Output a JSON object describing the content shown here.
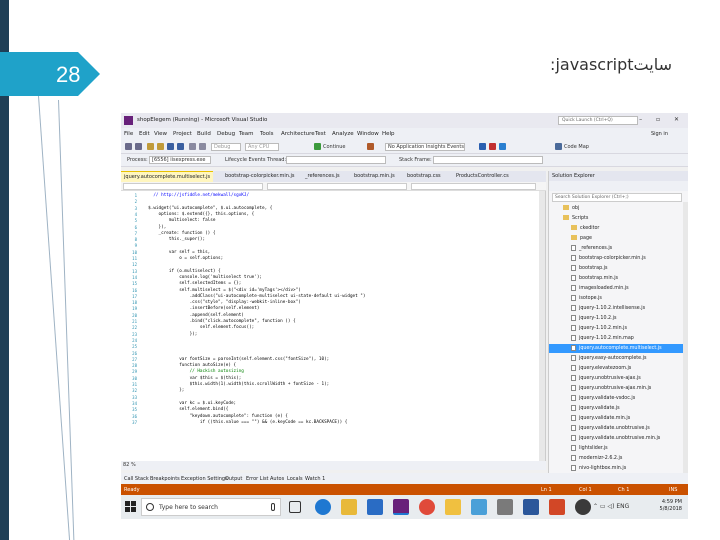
{
  "slide": {
    "number": "28",
    "title": ":javascriptسایت"
  },
  "vs": {
    "window_title": "shopElegem (Running) - Microsoft Visual Studio",
    "quick_launch": "Quick Launch (Ctrl+Q)",
    "sign_in": "Sign in",
    "menu": [
      "File",
      "Edit",
      "View",
      "Project",
      "Build",
      "Debug",
      "Team",
      "Tools",
      "Architecture",
      "Test",
      "Analyze",
      "Window",
      "Help"
    ],
    "toolbar": {
      "config": "Debug",
      "platform": "Any CPU",
      "continue": "Continue",
      "app_insights": "No Application Insights Events",
      "code_map": "Code Map",
      "process_label": "Process:",
      "process_value": "[6556] iisexpress.exe",
      "lifecycle": "Lifecycle Events",
      "thread": "Thread:",
      "stack_frame": "Stack Frame:"
    },
    "tabs": [
      "jquery.autocomplete.multiselect.js",
      "bootstrap-colorpicker.min.js",
      "_references.js",
      "bootstrap.min.js",
      "bootstrap.css",
      "ProductsController.cs"
    ],
    "line_numbers": [
      "1",
      "2",
      "3",
      "4",
      "5",
      "6",
      "7",
      "8",
      "9",
      "10",
      "11",
      "12",
      "13",
      "14",
      "15",
      "16",
      "17",
      "18",
      "19",
      "20",
      "21",
      "22",
      "23",
      "24",
      "25",
      "26",
      "27",
      "28",
      "29",
      "30",
      "31",
      "32",
      "33",
      "34",
      "35",
      "36",
      "37",
      "38",
      "39",
      "40",
      "41",
      "42",
      "43"
    ],
    "code": [
      "    // http://jsfiddle.net/mekwall/sgxKJ/",
      "",
      "  $.widget(\"ui.autocomplete\", $.ui.autocomplete, {",
      "      options: $.extend({}, this.options, {",
      "          multiselect: false",
      "      }),",
      "      _create: function () {",
      "          this._super();",
      "",
      "          var self = this,",
      "              o = self.options;",
      "",
      "          if (o.multiselect) {",
      "              console.log('multiselect true');",
      "              self.selectedItems = {};",
      "              self.multiselect = $(\"<div id='myTags'></div>\")",
      "                  .addClass(\"ui-autocomplete-multiselect ui-state-default ui-widget \")",
      "                  .css(\"style\", \"display:-webkit-inline-box\")",
      "                  .insertBefore(self.element)",
      "                  .append(self.element)",
      "                  .bind(\"click.autocomplete\", function () {",
      "                      self.element.focus();",
      "                  });",
      "",
      "",
      "",
      "              var fontSize = parseInt(self.element.css(\"fontSize\"), 10);",
      "              function autoSize(e) {",
      "                  // Hackish autosizing",
      "                  var $this = $(this);",
      "                  $this.width(1).width(this.scrollWidth + fontSize - 1);",
      "              };",
      "",
      "              var kc = $.ui.keyCode;",
      "              self.element.bind({",
      "                  \"keydown.autocomplete\": function (e) {",
      "                      if ((this.value === \"\") && (e.keyCode == kc.BACKSPACE)) {"
    ],
    "zoom": "82 %",
    "solution_explorer": {
      "title": "Solution Explorer",
      "search": "Search Solution Explorer (Ctrl+;)",
      "items": [
        {
          "label": "obj",
          "type": "folder",
          "indent": 1
        },
        {
          "label": "Scripts",
          "type": "folder",
          "indent": 1
        },
        {
          "label": "ckeditor",
          "type": "folder",
          "indent": 2
        },
        {
          "label": "page",
          "type": "folder",
          "indent": 2
        },
        {
          "label": "_references.js",
          "type": "file",
          "indent": 2
        },
        {
          "label": "bootstrap-colorpicker.min.js",
          "type": "file",
          "indent": 2
        },
        {
          "label": "bootstrap.js",
          "type": "file",
          "indent": 2
        },
        {
          "label": "bootstrap.min.js",
          "type": "file",
          "indent": 2
        },
        {
          "label": "imagesloaded.min.js",
          "type": "file",
          "indent": 2
        },
        {
          "label": "isotope.js",
          "type": "file",
          "indent": 2
        },
        {
          "label": "jquery-1.10.2.intellisense.js",
          "type": "file",
          "indent": 2
        },
        {
          "label": "jquery-1.10.2.js",
          "type": "file",
          "indent": 2
        },
        {
          "label": "jquery-1.10.2.min.js",
          "type": "file",
          "indent": 2
        },
        {
          "label": "jquery-1.10.2.min.map",
          "type": "file",
          "indent": 2
        },
        {
          "label": "jquery.autocomplete.multiselect.js",
          "type": "file",
          "indent": 2,
          "selected": true
        },
        {
          "label": "jquery.easy-autocomplete.js",
          "type": "file",
          "indent": 2
        },
        {
          "label": "jquery.elevatezoom.js",
          "type": "file",
          "indent": 2
        },
        {
          "label": "jquery.unobtrusive-ajax.js",
          "type": "file",
          "indent": 2
        },
        {
          "label": "jquery.unobtrusive-ajax.min.js",
          "type": "file",
          "indent": 2
        },
        {
          "label": "jquery.validate-vsdoc.js",
          "type": "file",
          "indent": 2
        },
        {
          "label": "jquery.validate.js",
          "type": "file",
          "indent": 2
        },
        {
          "label": "jquery.validate.min.js",
          "type": "file",
          "indent": 2
        },
        {
          "label": "jquery.validate.unobtrusive.js",
          "type": "file",
          "indent": 2
        },
        {
          "label": "jquery.validate.unobtrusive.min.js",
          "type": "file",
          "indent": 2
        },
        {
          "label": "lightslider.js",
          "type": "file",
          "indent": 2
        },
        {
          "label": "modernizr-2.6.2.js",
          "type": "file",
          "indent": 2
        },
        {
          "label": "nivo-lightbox.min.js",
          "type": "file",
          "indent": 2
        }
      ]
    },
    "bottom_tabs": [
      "Call Stack",
      "Breakpoints",
      "Exception Settings",
      "Output",
      "Error List",
      "Autos",
      "Locals",
      "Watch 1"
    ],
    "status": {
      "left": "Ready",
      "ln": "Ln 1",
      "col": "Col 1",
      "ch": "Ch 1",
      "ins": "INS"
    }
  },
  "taskbar": {
    "search_placeholder": "Type here to search",
    "time": "4:59 PM",
    "date": "5/8/2018",
    "lang": "ENG",
    "apps": [
      "task-view",
      "edge",
      "file-explorer",
      "store",
      "visual-studio",
      "chrome",
      "folder",
      "paint",
      "tools",
      "word",
      "powerpoint",
      "media"
    ]
  }
}
